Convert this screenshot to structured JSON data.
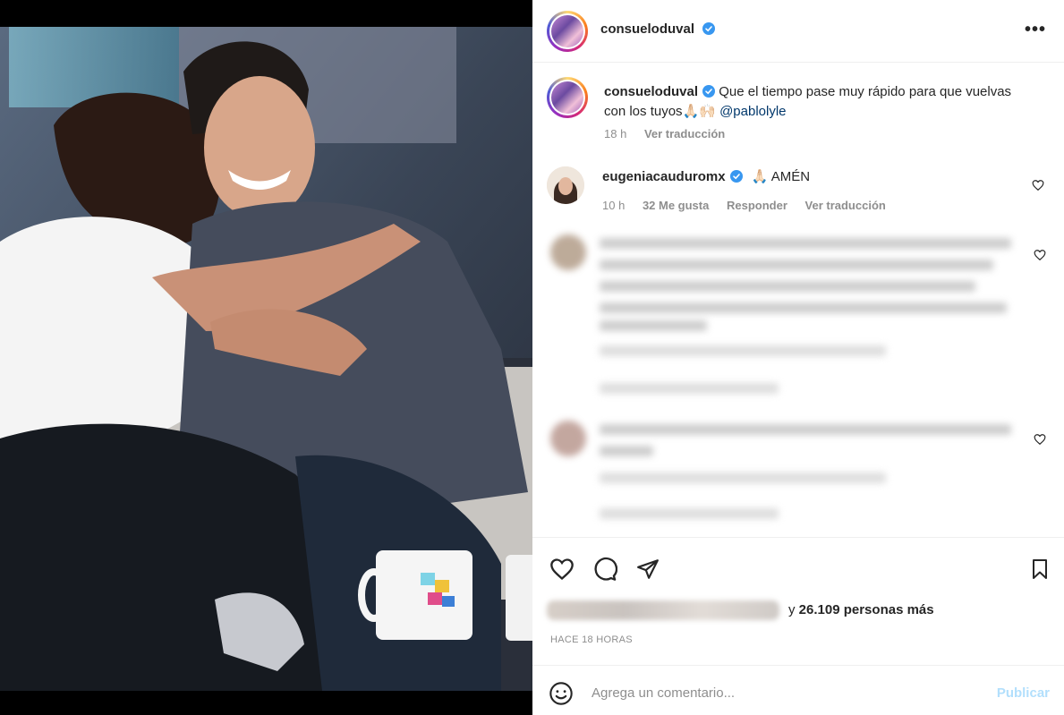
{
  "header": {
    "username": "consueloduval",
    "more_label": "•••"
  },
  "caption": {
    "username": "consueloduval",
    "text": "Que el tiempo pase muy rápido para que vuelvas con los tuyos🙏🏻🙌🏻 ",
    "mention": "@pablolyle",
    "time": "18 h",
    "translate": "Ver traducción"
  },
  "comments": [
    {
      "username": "eugeniacauduromx",
      "text": "🙏🏻 AMÉN",
      "time": "10 h",
      "likes": "32 Me gusta",
      "reply": "Responder",
      "translate": "Ver traducción"
    }
  ],
  "likes": {
    "suffix": "y ",
    "count": "26.109 personas más"
  },
  "posted_ago": "HACE 18 HORAS",
  "add_comment": {
    "placeholder": "Agrega un comentario...",
    "publish": "Publicar"
  },
  "colors": {
    "verified": "#3897f0",
    "mention": "#00376b",
    "publish_disabled": "#b2dffc"
  }
}
